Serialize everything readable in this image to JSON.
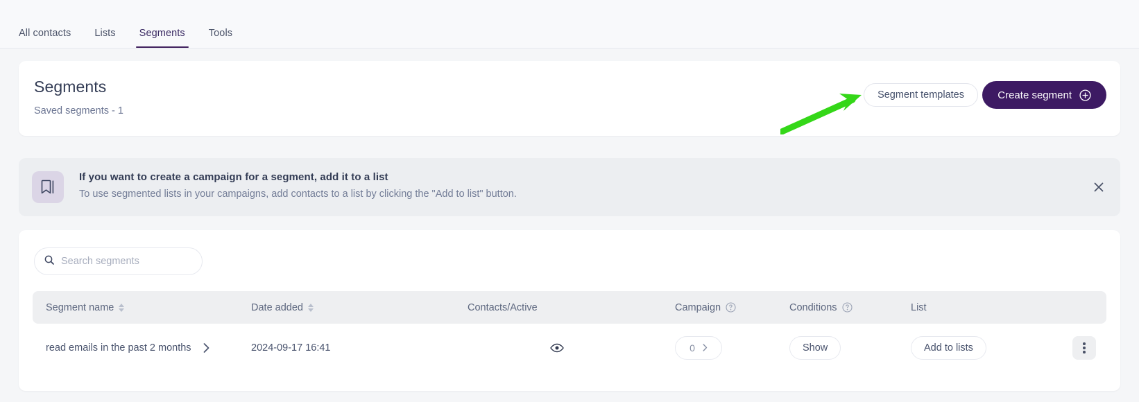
{
  "nav": {
    "tabs": [
      {
        "label": "All contacts",
        "active": false
      },
      {
        "label": "Lists",
        "active": false
      },
      {
        "label": "Segments",
        "active": true
      },
      {
        "label": "Tools",
        "active": false
      }
    ]
  },
  "header": {
    "title": "Segments",
    "subtitle": "Saved segments - 1",
    "templates_button": "Segment templates",
    "create_button": "Create segment"
  },
  "banner": {
    "title": "If you want to create a campaign for a segment, add it to a list",
    "subtitle": "To use segmented lists in your campaigns, add contacts to a list by clicking the \"Add to list\" button.",
    "icon": "bookmark-icon",
    "close_icon": "close-icon"
  },
  "search": {
    "placeholder": "Search segments",
    "value": "",
    "icon": "search-icon"
  },
  "table": {
    "columns": [
      {
        "label": "Segment name",
        "sortable": true,
        "help": false
      },
      {
        "label": "Date added",
        "sortable": true,
        "help": false
      },
      {
        "label": "Contacts/Active",
        "sortable": false,
        "help": false
      },
      {
        "label": "Campaign",
        "sortable": false,
        "help": true
      },
      {
        "label": "Conditions",
        "sortable": false,
        "help": true
      },
      {
        "label": "List",
        "sortable": false,
        "help": false
      }
    ],
    "rows": [
      {
        "segment_name": "read emails in the past 2 months",
        "date_added": "2024-09-17 16:41",
        "contacts_active_icon": "eye-icon",
        "campaign_count": "0",
        "conditions_button": "Show",
        "list_button": "Add to lists",
        "menu_icon": "kebab-menu-icon"
      }
    ]
  },
  "annotation": {
    "type": "arrow",
    "color": "#34d718",
    "points_to": "Segment templates"
  },
  "colors": {
    "brand_purple": "#3d1a63",
    "page_bg": "#f5f6f8",
    "accent_green": "#34d718"
  }
}
